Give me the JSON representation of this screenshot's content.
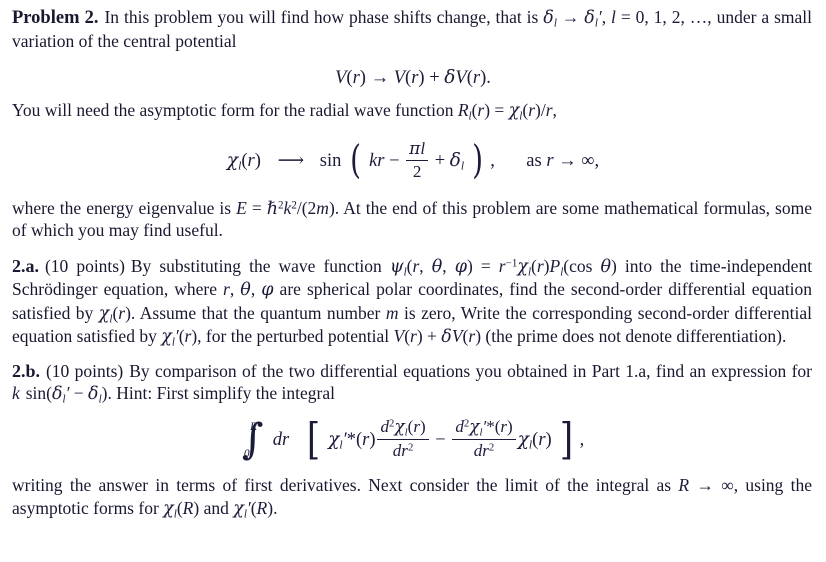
{
  "document": {
    "type": "physics-problem-sheet",
    "text_color": "#181830",
    "background_color": "#ffffff"
  },
  "problem": {
    "label": "Problem 2.",
    "intro_before_math": "In this problem you will find how phase shifts change, that is ",
    "phase_shift_map": "δl → δ'l,",
    "l_values": "l = 0, 1, 2, …,",
    "intro_after_math": "under a small variation of the central potential"
  },
  "equation_potential": {
    "name": "potential-perturbation",
    "V_of_r": "V(r)",
    "arrow": "→",
    "plus": "+",
    "delta_V": "δV(r)",
    "period": "."
  },
  "asymptotic_intro": {
    "text_before": "You will need the asymptotic form for the radial wave function ",
    "relation": "Rl(r) = χl(r)/r,"
  },
  "equation_asymptotic": {
    "name": "chi-asymptotic-form",
    "lhs": "χl(r)",
    "arrow": "⟶",
    "sin": "sin",
    "kr": "kr",
    "minus": "−",
    "pi_l": "πl",
    "two": "2",
    "plus": "+",
    "delta_l": "δl",
    "comma": ",",
    "condition": "as r → ∞,"
  },
  "energy_paragraph": {
    "text_before": "where the energy eigenvalue is ",
    "energy": "E = ħ²k²/(2m).",
    "text_after": " At the end of this problem are some mathematical formulas, some of which you may find useful."
  },
  "part_2a": {
    "label": "2.a.",
    "points": "(10 points)",
    "text_1": "By substituting the wave function ",
    "wave_function": "ψl(r, θ, φ) = r⁻¹χl(r)Pl(cos θ)",
    "text_2": " into the time-independent Schrödinger equation, where ",
    "coords": "r, θ, φ",
    "text_3": " are spherical polar coordinates, find the second-order differential equation satisfied by ",
    "chi_l": "χl(r).",
    "text_4": " Assume that the quantum number ",
    "m_var": "m",
    "text_5": " is zero, Write the corresponding second-order differential equation satisfied by ",
    "chi_l_prime": "χ'l(r),",
    "text_6": " for the perturbed potential ",
    "perturbed_potential": "V(r) + δV(r)",
    "text_7": " (the prime does not denote differentiation)."
  },
  "part_2b": {
    "label": "2.b.",
    "points": "(10 points)",
    "text_1": "By comparison of the two differential equations you obtained in Part 1.a, find an expression for ",
    "expression": "k sin(δ'l − δl).",
    "text_2": " Hint: First simplify the integral"
  },
  "equation_integral": {
    "name": "integral-hint",
    "limit_upper": "R",
    "limit_lower": "0",
    "dr": "dr",
    "term1_factor": "χ'l*(r)",
    "term1_num": "d²χl(r)",
    "term1_den": "dr²",
    "minus": "−",
    "term2_num": "d²χ'l*(r)",
    "term2_den": "dr²",
    "term2_factor": "χl(r)",
    "comma": ","
  },
  "closing_paragraph": {
    "text_1": "writing the answer in terms of first derivatives. Next consider the limit of the integral as ",
    "limit": "R → ∞,",
    "text_2": " using the asymptotic forms for ",
    "chi_R": "χl(R)",
    "and": " and ",
    "chi_prime_R": "χ'l(R)."
  }
}
